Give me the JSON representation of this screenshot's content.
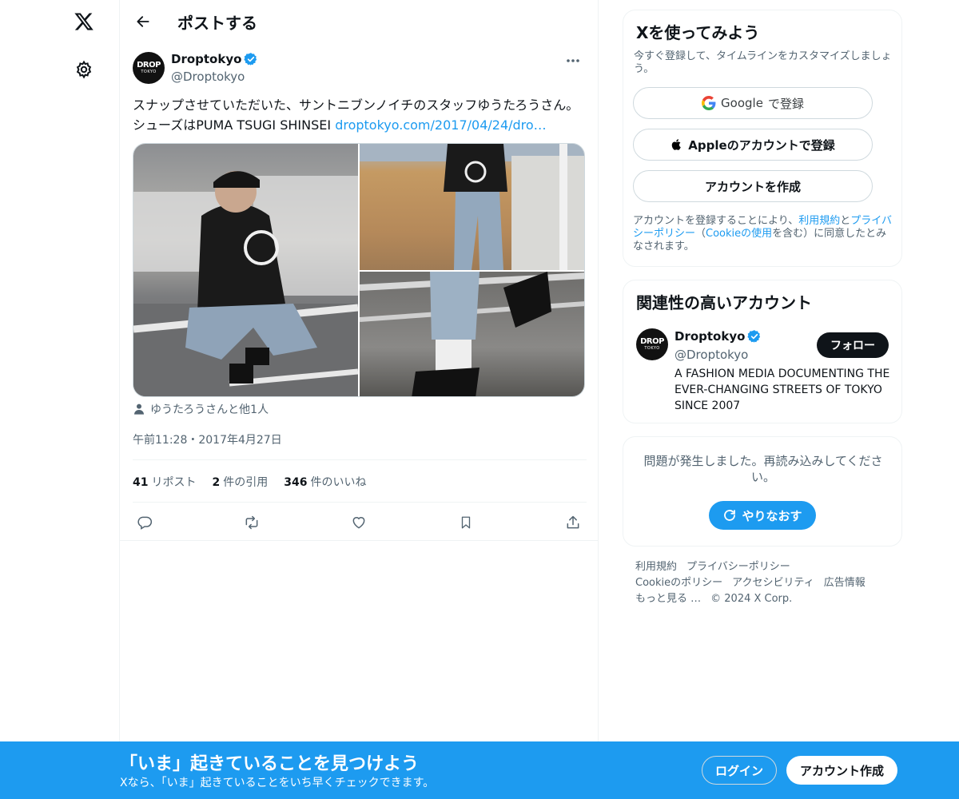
{
  "header": {
    "title": "ポストする"
  },
  "tweet": {
    "author_name": "Droptokyo",
    "author_handle": "@Droptokyo",
    "avatar_text": "DROP",
    "avatar_subtext": "TOKYO",
    "text_main": "スナップさせていただいた、サントニブンノイチのスタッフゆうたろうさん。 シューズはPUMA TSUGI SHINSEI ",
    "link_text": "droptokyo.com/2017/04/24/dro…",
    "tagged_text": "ゆうたろうさんと他1人",
    "timestamp": "午前11:28・2017年4月27日",
    "stats": {
      "reposts_count": "41",
      "reposts_label": "リポスト",
      "quotes_count": "2",
      "quotes_label": "件の引用",
      "likes_count": "346",
      "likes_label": "件のいいね"
    }
  },
  "signup_card": {
    "title": "Xを使ってみよう",
    "subtitle": "今すぐ登録して、タイムラインをカスタマイズしましょう。",
    "google_brand": "Google",
    "google_suffix": "で登録",
    "apple_label": "Appleのアカウントで登録",
    "create_label": "アカウントを作成",
    "legal_prefix": "アカウントを登録することにより、",
    "legal_terms": "利用規約",
    "legal_and": "と",
    "legal_privacy": "プライバシーポリシー",
    "legal_open": "（",
    "legal_cookie": "Cookieの使用",
    "legal_suffix": "を含む）に同意したとみなされます。"
  },
  "relevant_card": {
    "title": "関連性の高いアカウント",
    "name": "Droptokyo",
    "handle": "@Droptokyo",
    "follow_label": "フォロー",
    "bio": "A FASHION MEDIA DOCUMENTING THE EVER-CHANGING STREETS OF TOKYO SINCE 2007"
  },
  "error_card": {
    "message": "問題が発生しました。再読み込みしてください。",
    "retry_label": "やりなおす"
  },
  "footer": {
    "terms": "利用規約",
    "privacy": "プライバシーポリシー",
    "cookie": "Cookieのポリシー",
    "accessibility": "アクセシビリティ",
    "ads": "広告情報",
    "more": "もっと見る …",
    "copyright": "© 2024 X Corp."
  },
  "banner": {
    "title": "「いま」起きていることを見つけよう",
    "subtitle": "Xなら、「いま」起きていることをいち早くチェックできます。",
    "login_label": "ログイン",
    "signup_label": "アカウント作成"
  },
  "colors": {
    "accent": "#1d9bf0",
    "text": "#0f1419",
    "muted": "#536471",
    "border": "#eff3f4"
  }
}
